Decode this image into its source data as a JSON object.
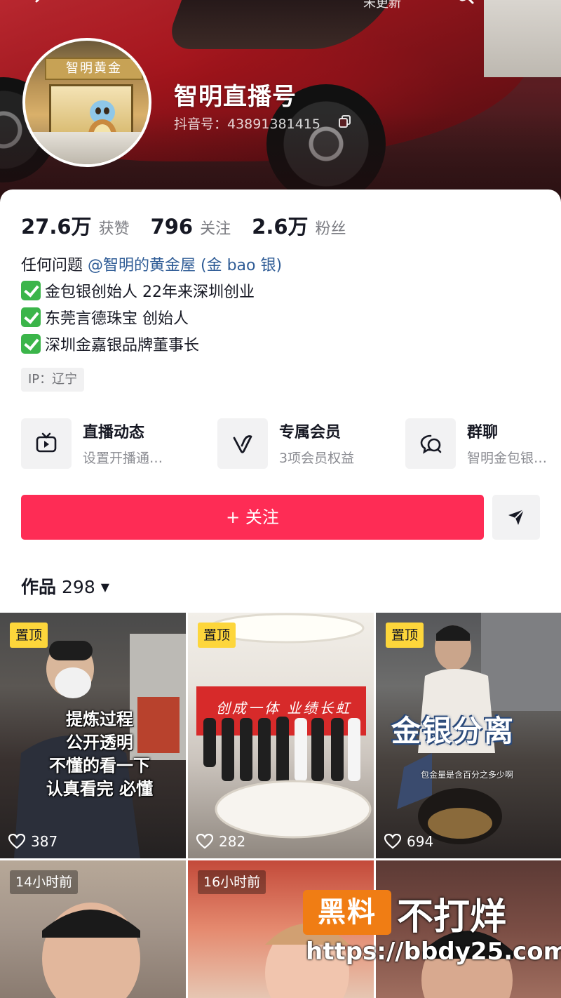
{
  "top_nav": {
    "update_label": "未更新"
  },
  "profile": {
    "name": "智明直播号",
    "douyin_id": "抖音号：43891381415",
    "avatar_sign": "智明黄金"
  },
  "stats": [
    {
      "value": "27.6万",
      "label": "获赞"
    },
    {
      "value": "796",
      "label": "关注"
    },
    {
      "value": "2.6万",
      "label": "粉丝"
    }
  ],
  "bio": {
    "prefix": "任何问题 ",
    "mention": "@智明的黄金屋 (金 bao 银)",
    "lines": [
      "金包银创始人 22年来深圳创业",
      "东莞言德珠宝  创始人",
      "深圳金嘉银品牌董事长"
    ]
  },
  "ip_tag": "IP：辽宁",
  "features": [
    {
      "title": "直播动态",
      "subtitle": "设置开播通…",
      "icon": "tv-icon"
    },
    {
      "title": "专属会员",
      "subtitle": "3项会员权益",
      "icon": "vip-icon"
    },
    {
      "title": "群聊",
      "subtitle": "智明金包银…",
      "icon": "chat-icon"
    }
  ],
  "follow_button": "+ 关注",
  "works": {
    "label": "作品",
    "count": "298",
    "caret": "▼"
  },
  "videos": [
    {
      "badge": "置顶",
      "likes": "387",
      "caption": [
        "提炼过程",
        "公开透明",
        "不懂的看一下",
        "认真看完 必懂"
      ]
    },
    {
      "badge": "置顶",
      "likes": "282",
      "banner_text": "创成一体 业绩长虹"
    },
    {
      "badge": "置顶",
      "likes": "694",
      "caption_big": "金银分离",
      "caption_small": "包金量是含百分之多少啊"
    },
    {
      "time": "14小时前"
    },
    {
      "time": "16小时前"
    },
    {
      "time": ""
    }
  ],
  "watermark": {
    "box": "黑料",
    "text": "不打烊",
    "url": "https://bbdy25.com"
  },
  "colors": {
    "accent": "#fe2c55",
    "pin": "#fdd63b",
    "mention": "#2f5c96"
  }
}
